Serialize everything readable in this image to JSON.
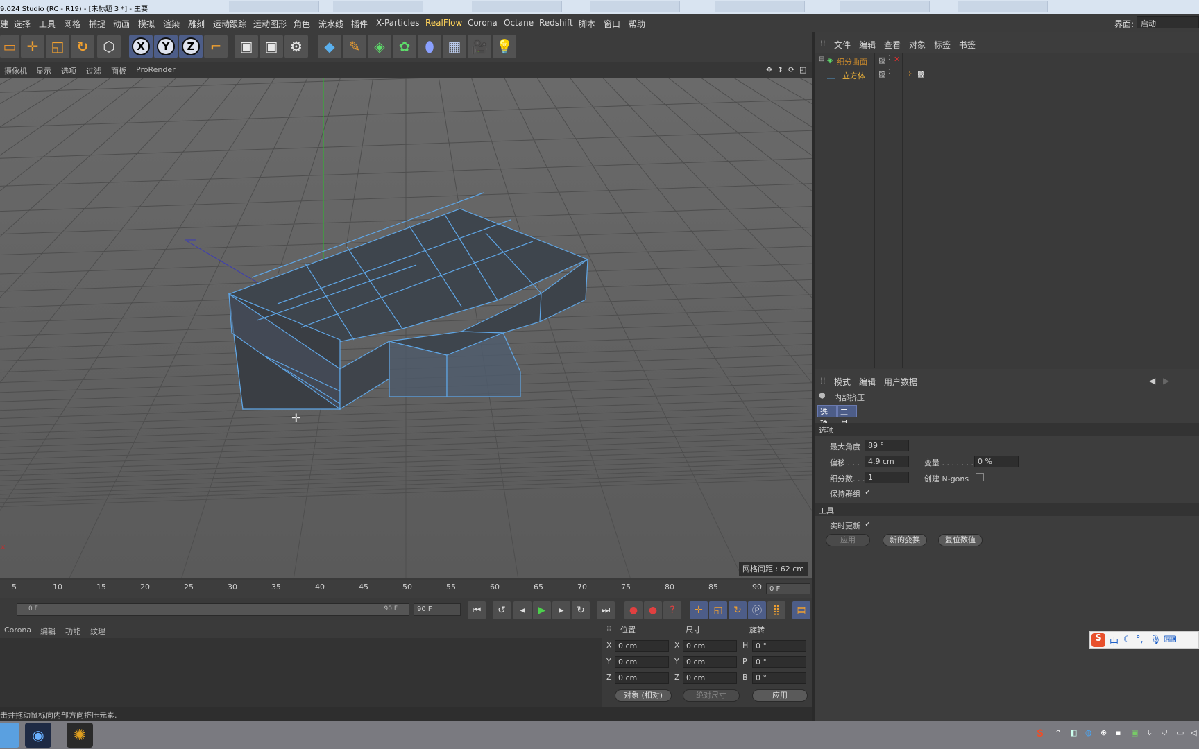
{
  "window": {
    "title": "9.024 Studio (RC - R19) - [未标题 3 *] - 主要"
  },
  "menubar": {
    "items": [
      "建",
      "选择",
      "工具",
      "网格",
      "捕捉",
      "动画",
      "模拟",
      "渲染",
      "雕刻",
      "运动跟踪",
      "运动图形",
      "角色",
      "流水线",
      "插件",
      "X-Particles",
      "RealFlow",
      "Corona",
      "Octane",
      "Redshift",
      "脚本",
      "窗口",
      "帮助"
    ],
    "interface_label": "界面:",
    "interface_value": "启动"
  },
  "toolbar": {
    "axis_x": "X",
    "axis_y": "Y",
    "axis_z": "Z"
  },
  "viewport": {
    "menu": [
      "摄像机",
      "显示",
      "选项",
      "过滤",
      "面板",
      "ProRender"
    ],
    "grid_spacing": "网格间距 : 62 cm"
  },
  "timeline": {
    "ticks": [
      "5",
      "10",
      "15",
      "20",
      "25",
      "30",
      "35",
      "40",
      "45",
      "50",
      "55",
      "60",
      "65",
      "70",
      "75",
      "80",
      "85",
      "90"
    ],
    "current_frame": "0 F",
    "slider_start": "0 F",
    "slider_end": "90 F",
    "end_frame": "90 F"
  },
  "material": {
    "menu": [
      "Corona",
      "编辑",
      "功能",
      "纹理"
    ]
  },
  "coords": {
    "headers": [
      "位置",
      "尺寸",
      "旋转"
    ],
    "rows": [
      {
        "axis": "X",
        "pos": "0 cm",
        "size_axis": "X",
        "size": "0 cm",
        "rot_axis": "H",
        "rot": "0 °"
      },
      {
        "axis": "Y",
        "pos": "0 cm",
        "size_axis": "Y",
        "size": "0 cm",
        "rot_axis": "P",
        "rot": "0 °"
      },
      {
        "axis": "Z",
        "pos": "0 cm",
        "size_axis": "Z",
        "size": "0 cm",
        "rot_axis": "B",
        "rot": "0 °"
      }
    ],
    "mode": "对象 (相对)",
    "size_mode": "绝对尺寸",
    "apply": "应用"
  },
  "status": "击并拖动鼠标向内部方向挤压元素.",
  "objects": {
    "menu": [
      "文件",
      "编辑",
      "查看",
      "对象",
      "标签",
      "书签"
    ],
    "items": [
      {
        "name": "细分曲面",
        "color": "#c9892c"
      },
      {
        "name": "立方体",
        "color": "#f0b53a"
      }
    ]
  },
  "attributes": {
    "menu": [
      "模式",
      "编辑",
      "用户数据"
    ],
    "tool_name": "内部挤压",
    "tabs": [
      "选项",
      "工具"
    ],
    "section_options": "选项",
    "max_angle_label": "最大角度",
    "max_angle": "89 °",
    "offset_label": "偏移 . . .",
    "offset": "4.9 cm",
    "variance_label": "变量 . . . . . . .",
    "variance": "0 %",
    "subdiv_label": "细分数. . .",
    "subdiv": "1",
    "ngons_label": "创建 N-gons",
    "keep_groups_label": "保持群组",
    "section_tool": "工具",
    "realtime_label": "实时更新",
    "btn_apply": "应用",
    "btn_new": "新的变换",
    "btn_reset": "复位数值"
  },
  "ime": {
    "lang": "中"
  }
}
